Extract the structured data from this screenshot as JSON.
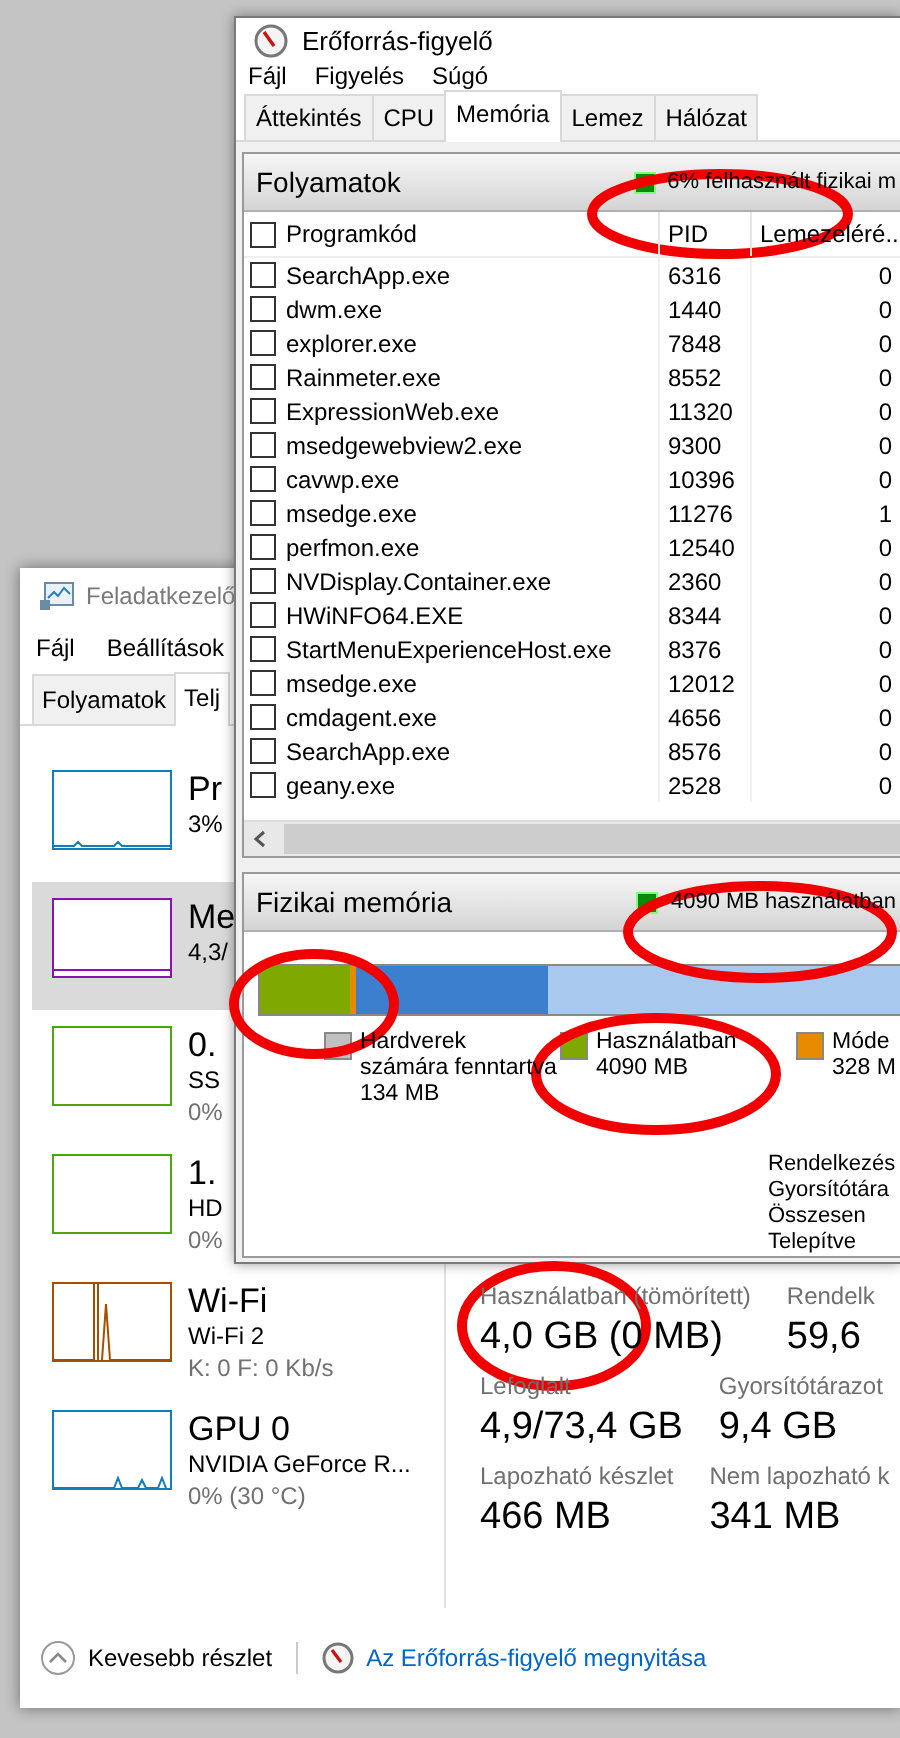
{
  "task_manager": {
    "title": "Feladatkezelő",
    "menu": [
      "Fájl",
      "Beállítások"
    ],
    "tabs": [
      {
        "label": "Folyamatok",
        "selected": false
      },
      {
        "label": "Telj",
        "selected": true
      }
    ],
    "sidebar": [
      {
        "name": "Pr",
        "lines": [
          "3%"
        ],
        "color": "#117dbb",
        "selected": false
      },
      {
        "name": "Me",
        "lines": [
          "4,3/"
        ],
        "color": "#8b12ae",
        "selected": true
      },
      {
        "name": "0.",
        "lines": [
          "SS",
          "0%"
        ],
        "color": "#4da60c",
        "selected": false
      },
      {
        "name": "1.",
        "lines": [
          "HD",
          "0%"
        ],
        "color": "#4da60c",
        "selected": false
      },
      {
        "name": "Wi-Fi",
        "lines": [
          "Wi-Fi 2",
          "K: 0 F: 0 Kb/s"
        ],
        "color": "#a74f01",
        "selected": false
      },
      {
        "name": "GPU 0",
        "lines": [
          "NVIDIA GeForce R...",
          "0%  (30 °C)"
        ],
        "color": "#117dbb",
        "selected": false
      }
    ],
    "stats": [
      {
        "label": "Használatban (tömörített)",
        "value": "4,0 GB (0 MB)"
      },
      {
        "label": "Rendelk",
        "value": "59,6"
      },
      {
        "label": "Lefoglalt",
        "value": "4,9/73,4 GB"
      },
      {
        "label": "Gyorsítótárazot",
        "value": "9,4 GB"
      },
      {
        "label": "Lapozható készlet",
        "value": "466 MB"
      },
      {
        "label": "Nem lapozható k",
        "value": "341 MB"
      }
    ],
    "footer": {
      "collapse_label": "Kevesebb részlet",
      "link": "Az Erőforrás-figyelő megnyitása"
    }
  },
  "resource_monitor": {
    "title": "Erőforrás-figyelő",
    "menu": [
      "Fájl",
      "Figyelés",
      "Súgó"
    ],
    "tabs": [
      {
        "label": "Áttekintés",
        "selected": false
      },
      {
        "label": "CPU",
        "selected": false
      },
      {
        "label": "Memória",
        "selected": true
      },
      {
        "label": "Lemez",
        "selected": false
      },
      {
        "label": "Hálózat",
        "selected": false
      }
    ],
    "processes": {
      "title": "Folyamatok",
      "summary": "6% felhasznált fizikai m",
      "columns": [
        "Programkód",
        "PID",
        "Lemezeléré..."
      ],
      "header_checked": false,
      "rows": [
        {
          "name": "SearchApp.exe",
          "pid": "6316",
          "column_3": "0",
          "checked": false
        },
        {
          "name": "dwm.exe",
          "pid": "1440",
          "column_3": "0",
          "checked": false
        },
        {
          "name": "explorer.exe",
          "pid": "7848",
          "column_3": "0",
          "checked": false
        },
        {
          "name": "Rainmeter.exe",
          "pid": "8552",
          "column_3": "0",
          "checked": false
        },
        {
          "name": "ExpressionWeb.exe",
          "pid": "11320",
          "column_3": "0",
          "checked": false
        },
        {
          "name": "msedgewebview2.exe",
          "pid": "9300",
          "column_3": "0",
          "checked": false
        },
        {
          "name": "cavwp.exe",
          "pid": "10396",
          "column_3": "0",
          "checked": false
        },
        {
          "name": "msedge.exe",
          "pid": "11276",
          "column_3": "1",
          "checked": false
        },
        {
          "name": "perfmon.exe",
          "pid": "12540",
          "column_3": "0",
          "checked": false
        },
        {
          "name": "NVDisplay.Container.exe",
          "pid": "2360",
          "column_3": "0",
          "checked": false
        },
        {
          "name": "HWiNFO64.EXE",
          "pid": "8344",
          "column_3": "0",
          "checked": false
        },
        {
          "name": "StartMenuExperienceHost.exe",
          "pid": "8376",
          "column_3": "0",
          "checked": false
        },
        {
          "name": "msedge.exe",
          "pid": "12012",
          "column_3": "0",
          "checked": false
        },
        {
          "name": "cmdagent.exe",
          "pid": "4656",
          "column_3": "0",
          "checked": false
        },
        {
          "name": "SearchApp.exe",
          "pid": "8576",
          "column_3": "0",
          "checked": false
        },
        {
          "name": "geany.exe",
          "pid": "2528",
          "column_3": "0",
          "checked": false
        }
      ]
    },
    "physical_memory": {
      "title": "Fizikai memória",
      "summary": "4090 MB használatban",
      "bar": [
        {
          "color": "#7fa800",
          "level": 0.14
        },
        {
          "color": "#e68a00",
          "level": 0.01
        },
        {
          "color": "#3d7fcf",
          "level": 0.3
        },
        {
          "color": "#a9c8ee",
          "level": 0.55
        }
      ],
      "legend": [
        {
          "label": "Hardverek számára fenntartva",
          "value": "134 MB",
          "color": "#c0c0c0"
        },
        {
          "label": "Használatban",
          "value": "4090 MB",
          "color": "#7fa800"
        },
        {
          "label": "Móde",
          "value": "328 M",
          "color": "#e68a00"
        }
      ],
      "totals": [
        "Rendelkezés",
        "Gyorsítótára",
        "Összesen",
        "Telepítve"
      ]
    }
  },
  "highlight_marks": [
    {
      "kind": "ellipse"
    },
    {
      "kind": "ellipse"
    },
    {
      "kind": "ellipse"
    },
    {
      "kind": "ellipse"
    },
    {
      "kind": "ellipse"
    }
  ]
}
